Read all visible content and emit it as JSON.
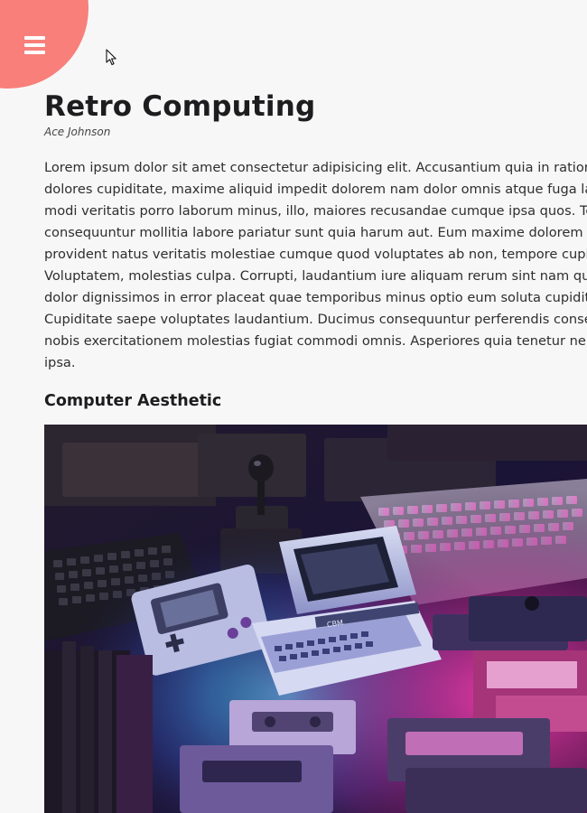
{
  "header": {
    "menu_icon": "hamburger-menu-icon",
    "accent_color": "#f87f7a"
  },
  "article": {
    "title": "Retro Computing",
    "author": "Ace Johnson",
    "body": "Lorem ipsum dolor sit amet consectetur adipisicing elit. Accusantium quia in ratione dolores cupiditate, maxime aliquid impedit dolorem nam dolor omnis atque fuga labo modi veritatis porro laborum minus, illo, maiores recusandae cumque ipsa quos. Tene consequuntur mollitia labore pariatur sunt quia harum aut. Eum maxime dolorem provident natus veritatis molestiae cumque quod voluptates ab non, tempore cupidit Voluptatem, molestias culpa. Corrupti, laudantium iure aliquam rerum sint nam quas dolor dignissimos in error placeat quae temporibus minus optio eum soluta cupiditate Cupiditate saepe voluptates laudantium. Ducimus consequuntur perferendis consequ nobis exercitationem molestias fugiat commodi omnis. Asperiores quia tenetur nemo ipsa.",
    "section_heading": "Computer Aesthetic",
    "image_cassette_label": "CBM"
  }
}
